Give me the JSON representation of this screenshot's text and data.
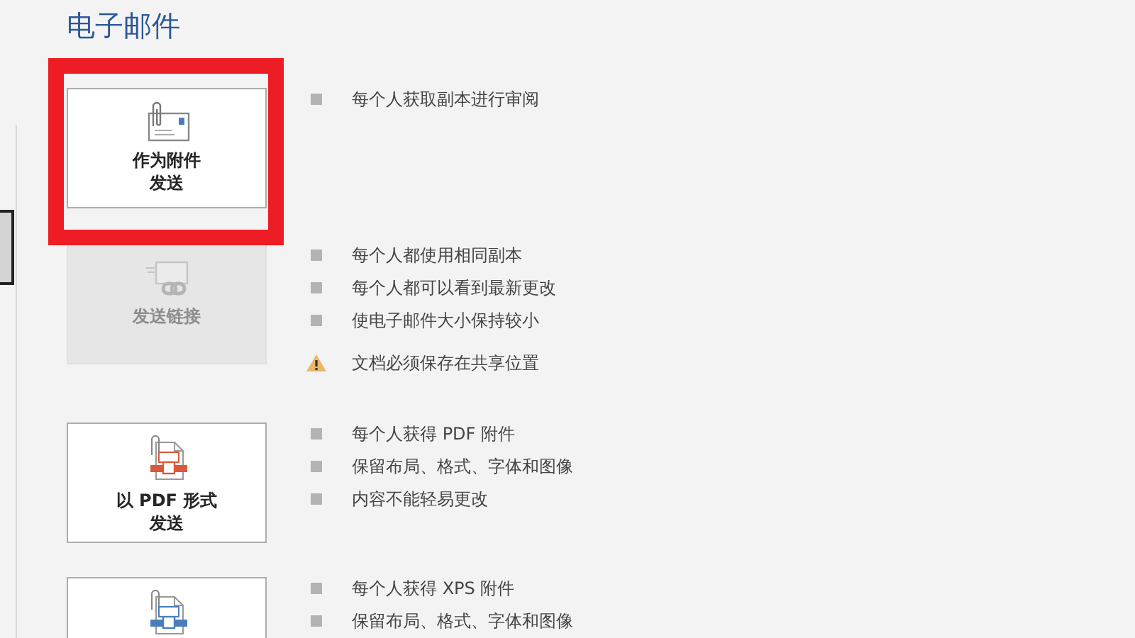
{
  "section_title": "电子邮件",
  "options": [
    {
      "kind": "attachment",
      "label_lines": [
        "作为附件",
        "发送"
      ],
      "disabled": false,
      "highlighted": true,
      "notes": [
        {
          "kind": "bullet",
          "text": "每个人获取副本进行审阅"
        }
      ]
    },
    {
      "kind": "link",
      "label_lines": [
        "发送链接"
      ],
      "disabled": true,
      "highlighted": false,
      "notes": [
        {
          "kind": "bullet",
          "text": "每个人都使用相同副本"
        },
        {
          "kind": "bullet",
          "text": "每个人都可以看到最新更改"
        },
        {
          "kind": "bullet",
          "text": "使电子邮件大小保持较小"
        },
        {
          "kind": "warning",
          "text": "文档必须保存在共享位置"
        }
      ]
    },
    {
      "kind": "pdf",
      "label_lines": [
        "以 PDF 形式",
        "发送"
      ],
      "disabled": false,
      "highlighted": false,
      "notes": [
        {
          "kind": "bullet",
          "text": "每个人获得 PDF 附件"
        },
        {
          "kind": "bullet",
          "text": "保留布局、格式、字体和图像"
        },
        {
          "kind": "bullet",
          "text": "内容不能轻易更改"
        }
      ]
    },
    {
      "kind": "xps",
      "disabled": false,
      "highlighted": false,
      "notes": [
        {
          "kind": "bullet",
          "text": "每个人获得 XPS 附件"
        },
        {
          "kind": "bullet",
          "text": "保留布局、格式、字体和图像"
        }
      ]
    }
  ]
}
